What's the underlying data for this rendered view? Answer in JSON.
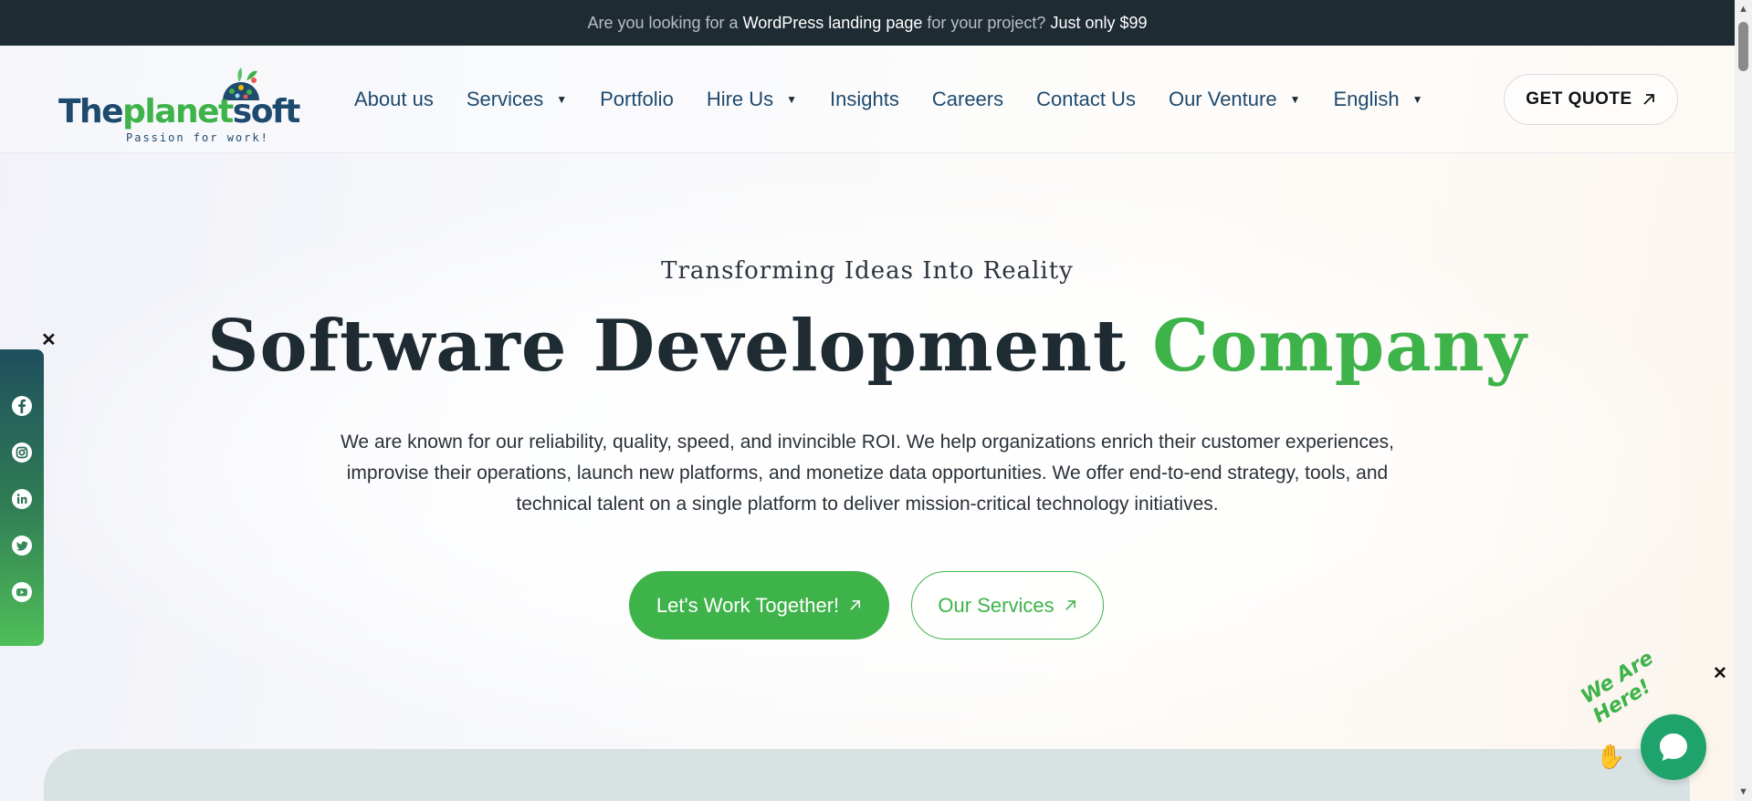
{
  "topbar": {
    "part1": "Are you looking for a ",
    "highlight1": "WordPress landing page",
    "part2": " for your project? ",
    "highlight2": "Just only $99"
  },
  "logo": {
    "text_part1": "The",
    "text_part2": "planet",
    "text_part3": "soft",
    "tagline": "Passion for work!"
  },
  "nav": {
    "items": [
      {
        "label": "About us",
        "dropdown": false
      },
      {
        "label": "Services",
        "dropdown": true
      },
      {
        "label": "Portfolio",
        "dropdown": false
      },
      {
        "label": "Hire Us",
        "dropdown": true
      },
      {
        "label": "Insights",
        "dropdown": false
      },
      {
        "label": "Careers",
        "dropdown": false
      },
      {
        "label": "Contact Us",
        "dropdown": false
      },
      {
        "label": "Our Venture",
        "dropdown": true
      },
      {
        "label": "English",
        "dropdown": true
      }
    ],
    "quote_label": "GET QUOTE"
  },
  "hero": {
    "eyebrow": "Transforming Ideas Into Reality",
    "headline_main": "Software Development ",
    "headline_accent": "Company",
    "description": "We are known for our reliability, quality, speed, and invincible ROI. We help organizations enrich their customer experiences, improvise their operations, launch new platforms, and monetize data opportunities. We offer end-to-end strategy, tools, and technical talent on a single platform to deliver mission-critical technology initiatives.",
    "primary_cta": "Let's Work Together!",
    "secondary_cta": "Our Services"
  },
  "social": [
    "facebook-icon",
    "instagram-icon",
    "linkedin-icon",
    "twitter-icon",
    "youtube-icon"
  ],
  "chat": {
    "tag": "We Are Here!"
  },
  "colors": {
    "brand_green": "#3eb34a",
    "dark": "#1e2b33",
    "nav_blue": "#1e4a6e",
    "chat_green": "#1fa36c"
  }
}
